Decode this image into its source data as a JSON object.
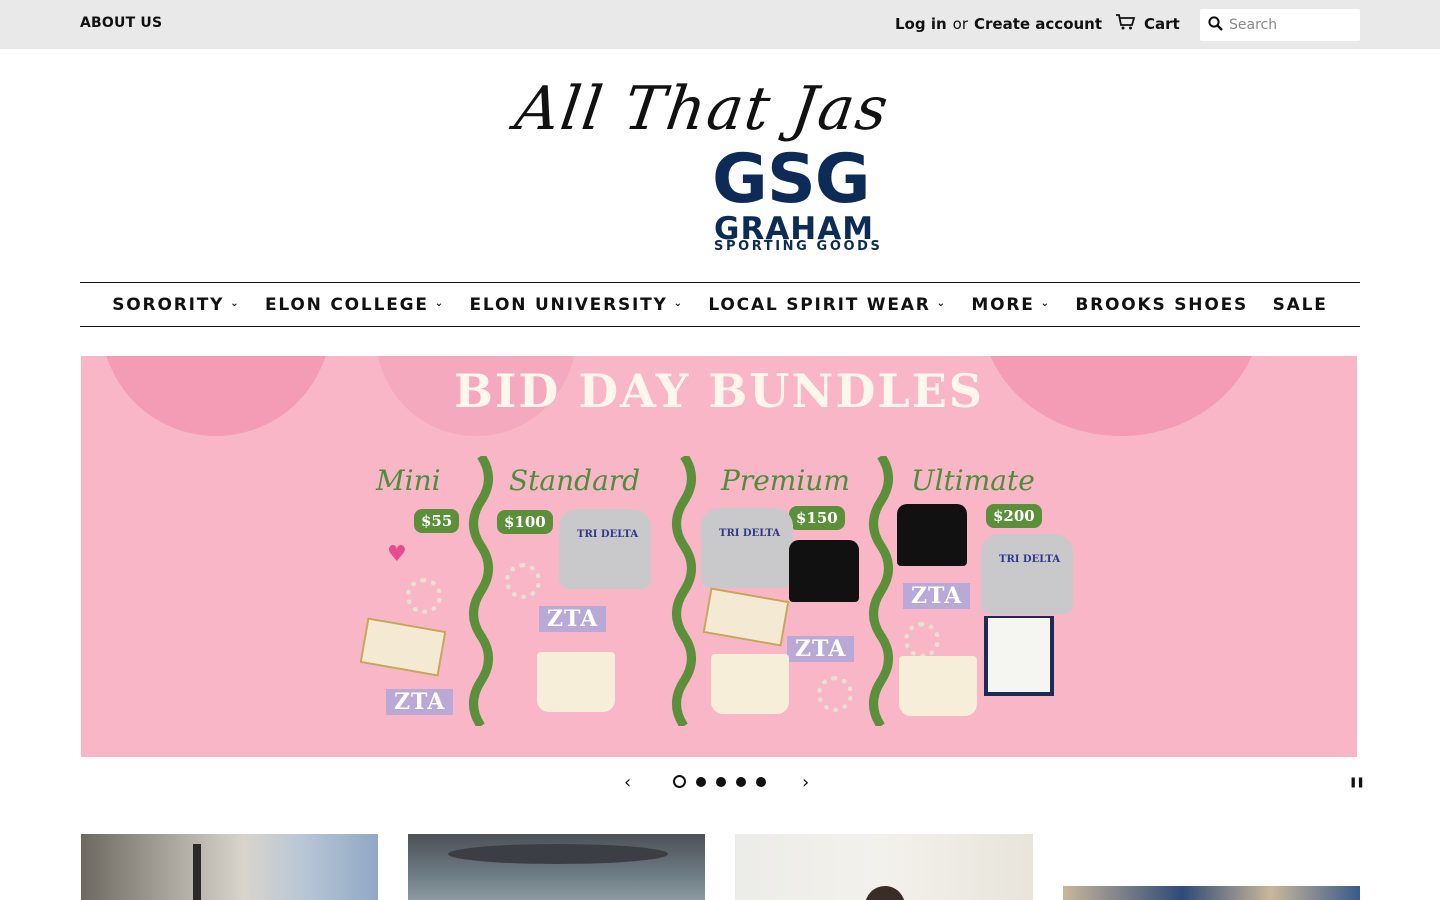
{
  "topbar": {
    "about_label": "ABOUT US",
    "login_label": "Log in",
    "or_label": "or",
    "create_account_label": "Create account",
    "cart_label": "Cart",
    "search_placeholder": "Search"
  },
  "logo": {
    "script_text": "All That Jas",
    "brand_mark": "GSG",
    "brand_name": "GRAHAM",
    "brand_sub": "SPORTING GOODS"
  },
  "nav": {
    "items": [
      {
        "label": "SORORITY",
        "has_dropdown": true
      },
      {
        "label": "ELON COLLEGE",
        "has_dropdown": true
      },
      {
        "label": "ELON UNIVERSITY",
        "has_dropdown": true
      },
      {
        "label": "LOCAL SPIRIT WEAR",
        "has_dropdown": true
      },
      {
        "label": "MORE",
        "has_dropdown": true
      },
      {
        "label": "BROOKS SHOES",
        "has_dropdown": false
      },
      {
        "label": "SALE",
        "has_dropdown": false
      }
    ]
  },
  "hero": {
    "title": "BID DAY BUNDLES",
    "bundles": [
      {
        "name": "Mini",
        "price": "$55"
      },
      {
        "name": "Standard",
        "price": "$100"
      },
      {
        "name": "Premium",
        "price": "$150"
      },
      {
        "name": "Ultimate",
        "price": "$200"
      }
    ],
    "letters": "ZTA",
    "sweatshirt_text": "TRI DELTA",
    "colors": {
      "background": "#f8b6c6",
      "accent_green": "#5b8f3a",
      "label_purple": "#b9a9d6"
    }
  },
  "slider": {
    "slide_count": 5,
    "active_slide": 1
  },
  "colors": {
    "topbar_bg": "#e9e9e9",
    "brand_navy": "#0d2b57"
  }
}
